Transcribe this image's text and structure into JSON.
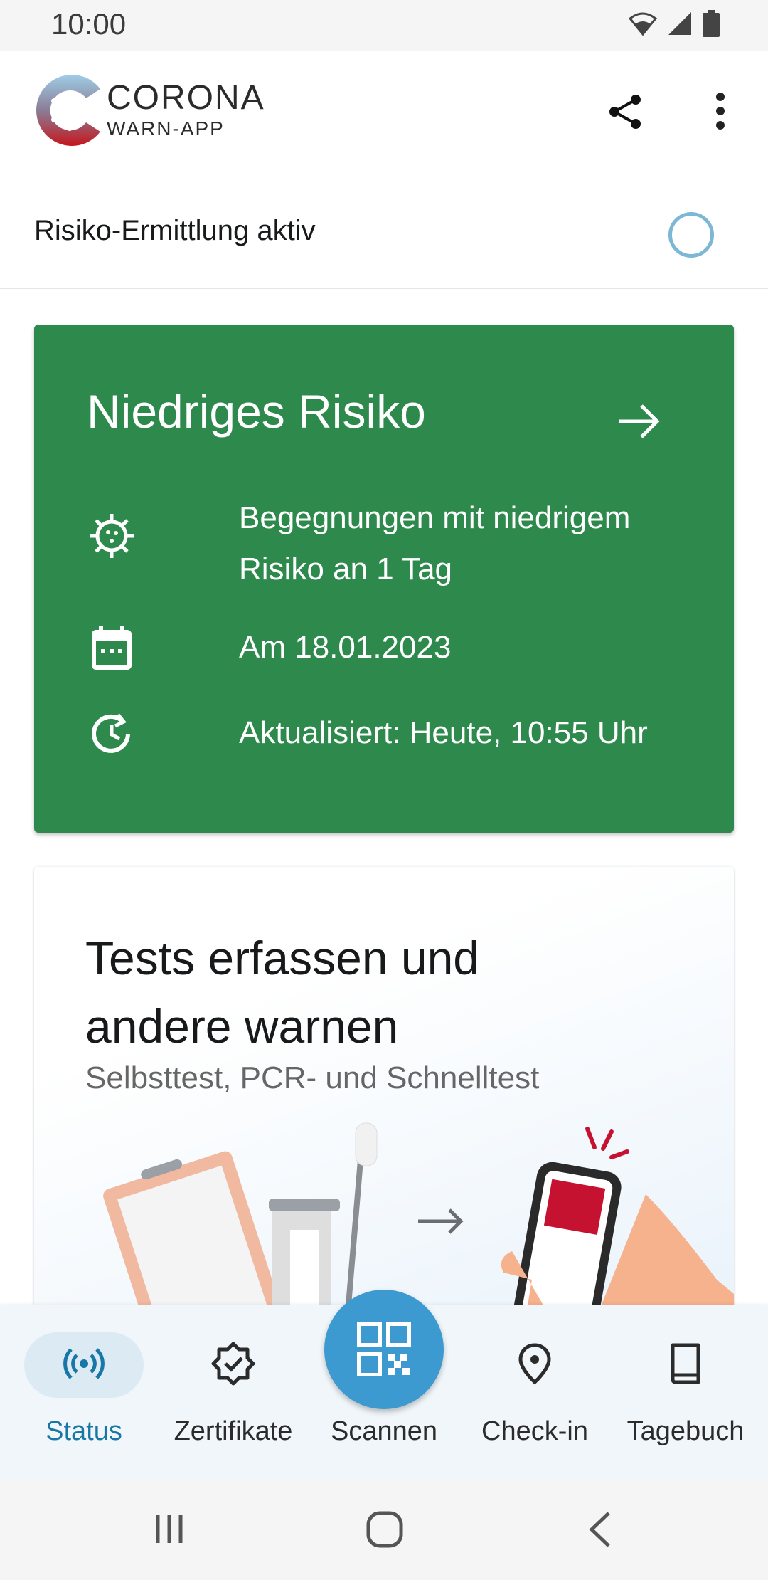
{
  "status_bar": {
    "time": "10:00"
  },
  "app": {
    "logo_line1": "CORONA",
    "logo_line2": "WARN-APP"
  },
  "tracing": {
    "label": "Risiko-Ermittlung aktiv"
  },
  "risk_card": {
    "title": "Niedriges Risiko",
    "encounters": "Begegnungen mit niedrigem Risiko an 1 Tag",
    "date": "Am 18.01.2023",
    "updated": "Aktualisiert: Heute, 10:55 Uhr",
    "color": "#2e8a4c"
  },
  "tests_card": {
    "title": "Tests erfassen und andere warnen",
    "subtitle": "Selbsttest, PCR- und Schnelltest"
  },
  "bottom_nav": {
    "items": [
      {
        "label": "Status",
        "icon": "broadcast-icon",
        "active": true
      },
      {
        "label": "Zertifikate",
        "icon": "certificate-badge-icon"
      },
      {
        "label": "Scannen",
        "icon": "qr-code-icon"
      },
      {
        "label": "Check-in",
        "icon": "location-pin-icon"
      },
      {
        "label": "Tagebuch",
        "icon": "book-icon"
      }
    ]
  },
  "colors": {
    "accent": "#3c9ad0",
    "active_nav": "#1977a7"
  }
}
